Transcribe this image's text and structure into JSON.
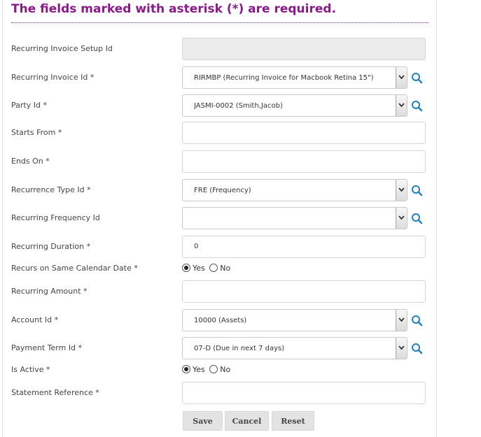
{
  "form": {
    "heading": "The fields marked with asterisk (*) are required.",
    "fields": {
      "setup_id": {
        "label": "Recurring Invoice Setup Id",
        "value": ""
      },
      "invoice_id": {
        "label": "Recurring Invoice Id *",
        "value": "RIRMBP (Recurring Invoice for Macbook Retina 15\")"
      },
      "party_id": {
        "label": "Party Id *",
        "value": "JASMI-0002 (Smith,Jacob)"
      },
      "starts_from": {
        "label": "Starts From *",
        "value": ""
      },
      "ends_on": {
        "label": "Ends On *",
        "value": ""
      },
      "recurrence_type": {
        "label": "Recurrence Type Id *",
        "value": "FRE (Frequency)"
      },
      "frequency_id": {
        "label": "Recurring Frequency Id",
        "value": ""
      },
      "duration": {
        "label": "Recurring Duration *",
        "value": "0"
      },
      "same_date": {
        "label": "Recurs on Same Calendar Date *",
        "yes": "Yes",
        "no": "No",
        "selected": "Yes"
      },
      "amount": {
        "label": "Recurring Amount *",
        "value": ""
      },
      "account_id": {
        "label": "Account Id *",
        "value": "10000 (Assets)"
      },
      "payment_term": {
        "label": "Payment Term Id *",
        "value": "07-D (Due in next 7 days)"
      },
      "is_active": {
        "label": "Is Active *",
        "yes": "Yes",
        "no": "No",
        "selected": "Yes"
      },
      "statement_ref": {
        "label": "Statement Reference *",
        "value": ""
      }
    },
    "buttons": {
      "save": "Save",
      "cancel": "Cancel",
      "reset": "Reset"
    }
  },
  "icons": {
    "lookup": "search-icon",
    "dropdown": "chevron-down-icon"
  },
  "colors": {
    "heading": "#8b1a8b",
    "lookup_icon": "#1f7fbf",
    "button_bg": "#e3e3e3"
  }
}
